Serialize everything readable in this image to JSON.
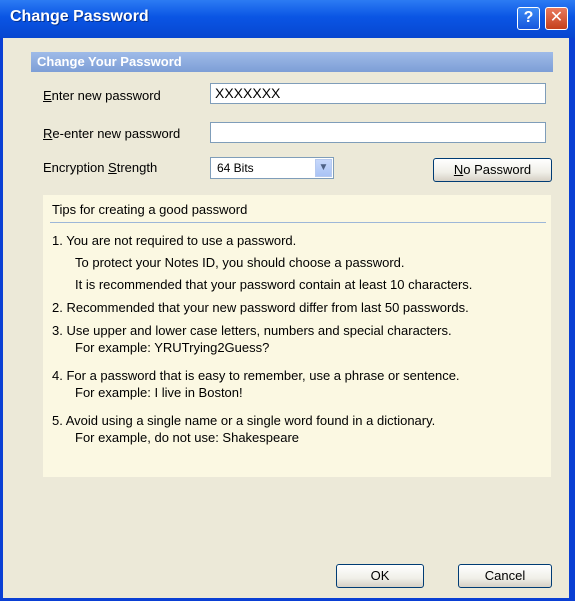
{
  "window": {
    "title": "Change Password",
    "help_glyph": "?",
    "close_glyph": "✕"
  },
  "section": {
    "header": "Change Your Password"
  },
  "form": {
    "new_password_label_accel": "E",
    "new_password_label_rest": "nter new password",
    "new_password_value": "XXXXXXX",
    "reenter_label_accel": "R",
    "reenter_label_rest": "e-enter new password",
    "reenter_value": "",
    "encryption_label_pre": "Encryption ",
    "encryption_label_accel": "S",
    "encryption_label_rest": "trength",
    "encryption_selected": "64 Bits",
    "no_password_accel": "N",
    "no_password_rest": "o Password"
  },
  "tips": {
    "title": "Tips for creating a good password",
    "lines": [
      "1.  You are not required to use a password.",
      "To protect your Notes ID, you should choose a password.",
      "It is recommended that your password contain at least 10 characters.",
      "2.  Recommended that your new password differ from last 50 passwords.",
      "3.  Use upper and lower case letters, numbers and special characters.",
      "For example:  YRUTrying2Guess?",
      "4.  For a password that is easy to remember, use a phrase or sentence.",
      "For example:  I live in Boston!",
      "5.  Avoid using a single name or a single word found in a dictionary.",
      "For example, do not use:  Shakespeare"
    ]
  },
  "buttons": {
    "ok": "OK",
    "cancel": "Cancel"
  }
}
